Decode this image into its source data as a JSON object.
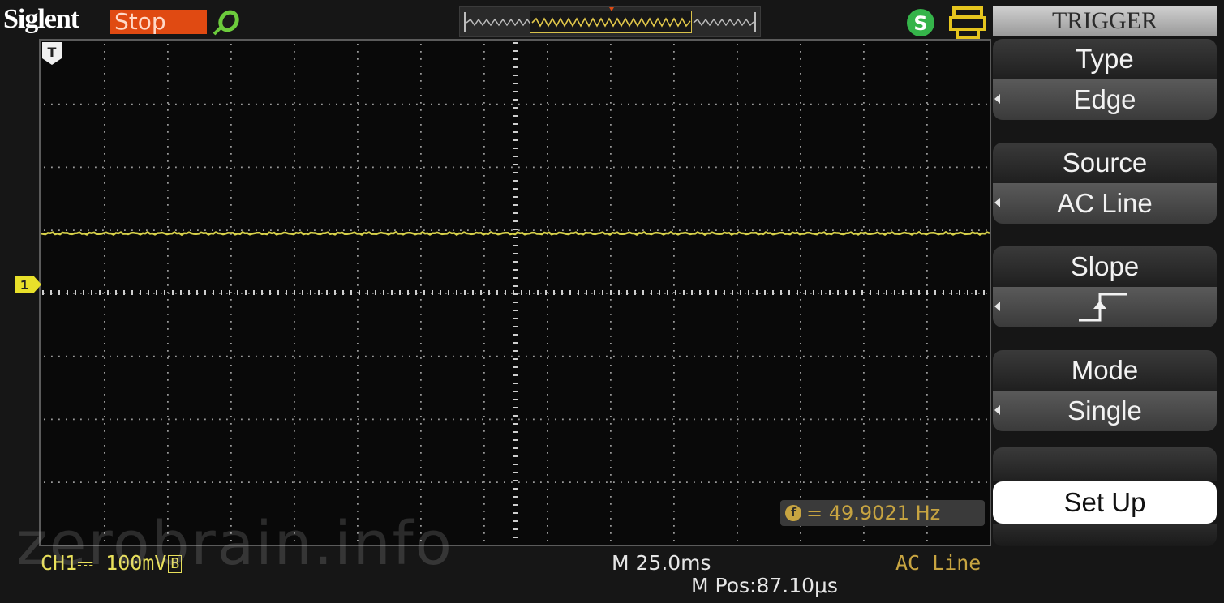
{
  "header": {
    "brand": "Siglent",
    "run_state": "Stop",
    "run_state_color": "#e04a12"
  },
  "icons": {
    "probe": "probe-icon",
    "usb": "usb-icon",
    "printer": "printer-icon",
    "trigger_position": "trigger-position-icon",
    "channel_marker": "channel-1-marker-icon",
    "frequency": "frequency-counter-icon",
    "slope": "rising-edge-icon"
  },
  "channel": {
    "marker_label": "1",
    "trace_color": "#d8d24a"
  },
  "trigger_marker_label": "T",
  "frequency_readout": {
    "icon_label": "f",
    "text": "= 49.9021 Hz"
  },
  "status": {
    "ch1_scale": "CH1⎓ 100mV",
    "ch1_bw_label": "B",
    "timebase": "M 25.0ms",
    "horizontal_position": "M Pos:87.10μs",
    "trigger_source": "AC Line"
  },
  "watermark": "zerobrain.info",
  "menu": {
    "title": "TRIGGER",
    "items": [
      {
        "label": "Type",
        "value": "Edge"
      },
      {
        "label": "Source",
        "value": "AC Line"
      },
      {
        "label": "Slope",
        "value": ""
      },
      {
        "label": "Mode",
        "value": "Single"
      }
    ],
    "setup_label": "Set Up"
  }
}
